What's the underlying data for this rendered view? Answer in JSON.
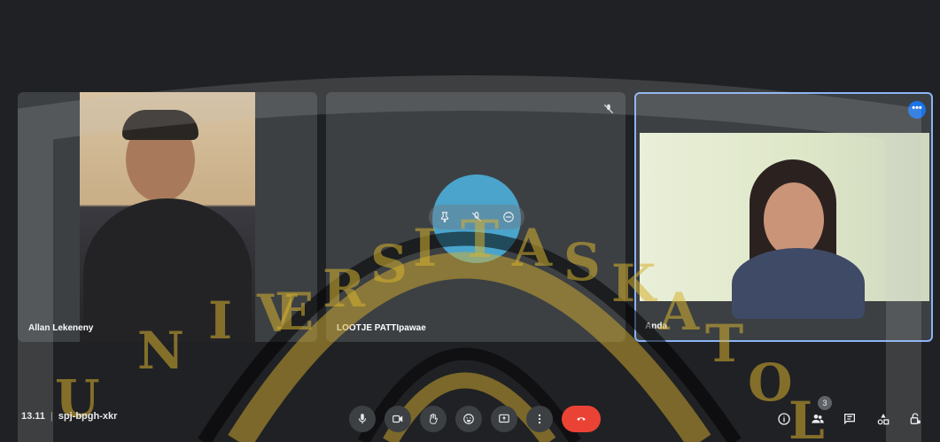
{
  "participants": [
    {
      "name": "Allan Lekeneny"
    },
    {
      "name": "LOOTJE PATTIpawae"
    },
    {
      "name": "Anda"
    }
  ],
  "meeting": {
    "time": "13.11",
    "separator": "|",
    "code": "spj-bpgh-xkr"
  },
  "people_count": "3",
  "watermark": {
    "letters": [
      "U",
      "N",
      "I",
      "V",
      "E",
      "R",
      "S",
      "I",
      "T",
      "A",
      "S",
      "K",
      "A",
      "T",
      "O",
      "L"
    ]
  },
  "more_label": "•••",
  "colors": {
    "background": "#202124",
    "tile": "#3c4043",
    "active_border": "#8ab4f8",
    "end_call": "#ea4335",
    "hover": "#4db6e3"
  },
  "icons": [
    "mic-icon",
    "camera-icon",
    "raise-hand-icon",
    "emoji-icon",
    "present-icon",
    "more-vert-icon",
    "end-call-icon",
    "info-icon",
    "people-icon",
    "chat-icon",
    "activities-icon",
    "host-controls-icon",
    "pin-icon",
    "mute-icon",
    "remove-icon"
  ]
}
